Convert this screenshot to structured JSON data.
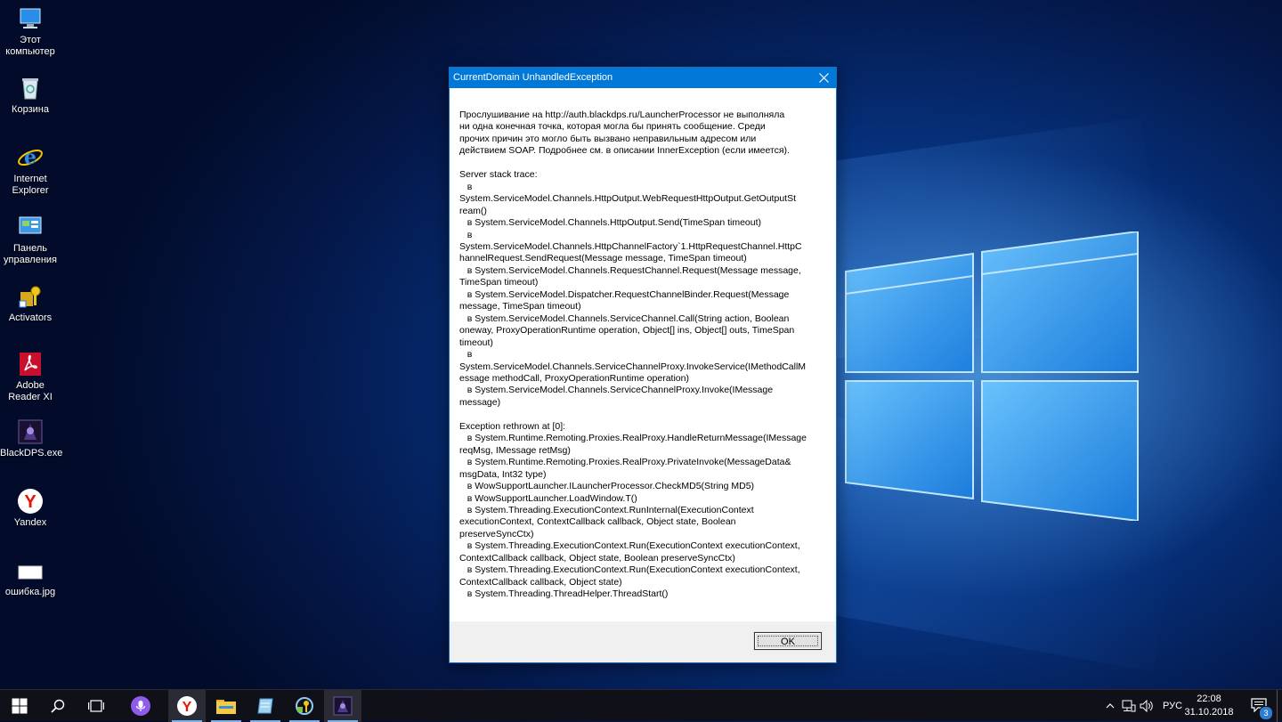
{
  "desktop": {
    "icons": [
      {
        "label": "Этот\nкомпьютер",
        "icon": "computer-icon"
      },
      {
        "label": "Корзина",
        "icon": "recycle-bin-icon"
      },
      {
        "label": "Internet\nExplorer",
        "icon": "internet-explorer-icon"
      },
      {
        "label": "Панель\nуправления",
        "icon": "control-panel-icon"
      },
      {
        "label": "Activators",
        "icon": "activators-icon"
      },
      {
        "label": "Adobe\nReader XI",
        "icon": "adobe-reader-icon"
      },
      {
        "label": "BlackDPS.exe",
        "icon": "blackdps-icon"
      },
      {
        "label": "Yandex",
        "icon": "yandex-icon"
      },
      {
        "label": "ошибка.jpg",
        "icon": "image-file-icon"
      }
    ]
  },
  "dialog": {
    "title": "CurrentDomain UnhandledException",
    "message": "Прослушивание на http://auth.blackdps.ru/LauncherProcessor не выполняла\nни одна конечная точка, которая могла бы принять сообщение. Среди\nпрочих причин это могло быть вызвано неправильным адресом или\nдействием SOAP. Подробнее см. в описании InnerException (если имеется).\n\nServer stack trace:\n   в\nSystem.ServiceModel.Channels.HttpOutput.WebRequestHttpOutput.GetOutputSt\nream()\n   в System.ServiceModel.Channels.HttpOutput.Send(TimeSpan timeout)\n   в\nSystem.ServiceModel.Channels.HttpChannelFactory`1.HttpRequestChannel.HttpC\nhannelRequest.SendRequest(Message message, TimeSpan timeout)\n   в System.ServiceModel.Channels.RequestChannel.Request(Message message,\nTimeSpan timeout)\n   в System.ServiceModel.Dispatcher.RequestChannelBinder.Request(Message\nmessage, TimeSpan timeout)\n   в System.ServiceModel.Channels.ServiceChannel.Call(String action, Boolean\noneway, ProxyOperationRuntime operation, Object[] ins, Object[] outs, TimeSpan\ntimeout)\n   в\nSystem.ServiceModel.Channels.ServiceChannelProxy.InvokeService(IMethodCallM\nessage methodCall, ProxyOperationRuntime operation)\n   в System.ServiceModel.Channels.ServiceChannelProxy.Invoke(IMessage\nmessage)\n\nException rethrown at [0]:\n   в System.Runtime.Remoting.Proxies.RealProxy.HandleReturnMessage(IMessage\nreqMsg, IMessage retMsg)\n   в System.Runtime.Remoting.Proxies.RealProxy.PrivateInvoke(MessageData&\nmsgData, Int32 type)\n   в WowSupportLauncher.ILauncherProcessor.CheckMD5(String MD5)\n   в WowSupportLauncher.LoadWindow.T()\n   в System.Threading.ExecutionContext.RunInternal(ExecutionContext\nexecutionContext, ContextCallback callback, Object state, Boolean\npreserveSyncCtx)\n   в System.Threading.ExecutionContext.Run(ExecutionContext executionContext,\nContextCallback callback, Object state, Boolean preserveSyncCtx)\n   в System.Threading.ExecutionContext.Run(ExecutionContext executionContext,\nContextCallback callback, Object state)\n   в System.Threading.ThreadHelper.ThreadStart()",
    "ok_label": "OK"
  },
  "taskbar": {
    "apps": [
      "yandex-browser-icon",
      "file-explorer-icon",
      "notepad-icon",
      "activators-icon",
      "blackdps-icon"
    ],
    "language": "РУС",
    "time": "22:08",
    "date": "31.10.2018",
    "notification_count": "3"
  }
}
